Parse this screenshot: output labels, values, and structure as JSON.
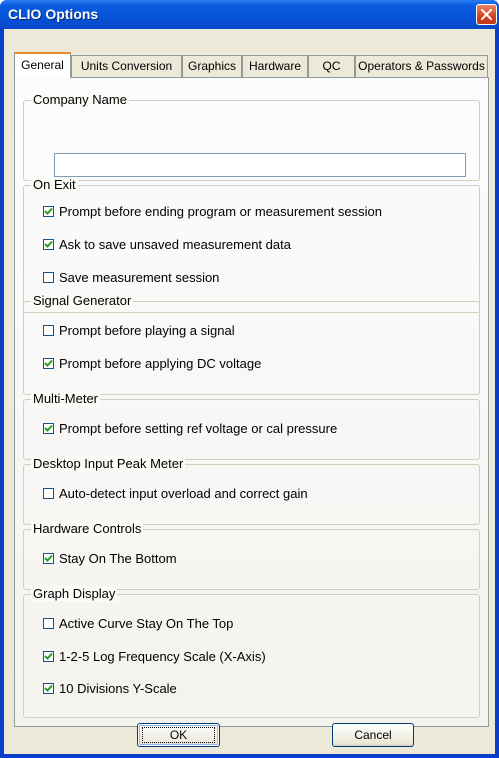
{
  "window": {
    "title": "CLIO Options"
  },
  "tabs": [
    {
      "label": "General",
      "active": true
    },
    {
      "label": "Units Conversion",
      "active": false
    },
    {
      "label": "Graphics",
      "active": false
    },
    {
      "label": "Hardware",
      "active": false
    },
    {
      "label": "QC",
      "active": false
    },
    {
      "label": "Operators & Passwords",
      "active": false
    }
  ],
  "company_name": {
    "label": "Company Name",
    "value": "",
    "placeholder": ""
  },
  "on_exit": {
    "label": "On Exit",
    "items": [
      {
        "label": "Prompt before ending program or measurement session",
        "checked": true
      },
      {
        "label": "Ask to save unsaved measurement data",
        "checked": true
      },
      {
        "label": "Save measurement session",
        "checked": false
      }
    ]
  },
  "signal_generator": {
    "label": "Signal Generator",
    "items": [
      {
        "label": "Prompt before playing a signal",
        "checked": false
      },
      {
        "label": "Prompt before applying DC voltage",
        "checked": true
      }
    ]
  },
  "multi_meter": {
    "label": "Multi-Meter",
    "items": [
      {
        "label": "Prompt before setting ref voltage or cal pressure",
        "checked": true
      }
    ]
  },
  "desktop_peak_meter": {
    "label": "Desktop Input Peak Meter",
    "items": [
      {
        "label": "Auto-detect input overload and correct gain",
        "checked": false
      }
    ]
  },
  "hardware_controls": {
    "label": "Hardware Controls",
    "items": [
      {
        "label": "Stay On The Bottom",
        "checked": true
      }
    ]
  },
  "graph_display": {
    "label": "Graph Display",
    "items": [
      {
        "label": "Active Curve Stay On The Top",
        "checked": false
      },
      {
        "label": "1-2-5 Log Frequency Scale (X-Axis)",
        "checked": true
      },
      {
        "label": "10 Divisions Y-Scale",
        "checked": true
      }
    ]
  },
  "buttons": {
    "ok": "OK",
    "cancel": "Cancel"
  },
  "icons": {
    "close": "close-icon",
    "check": "check-icon"
  },
  "colors": {
    "title_bar": "#0553d8",
    "active_tab_highlight": "#e68b2c",
    "close_button": "#d4411c"
  }
}
